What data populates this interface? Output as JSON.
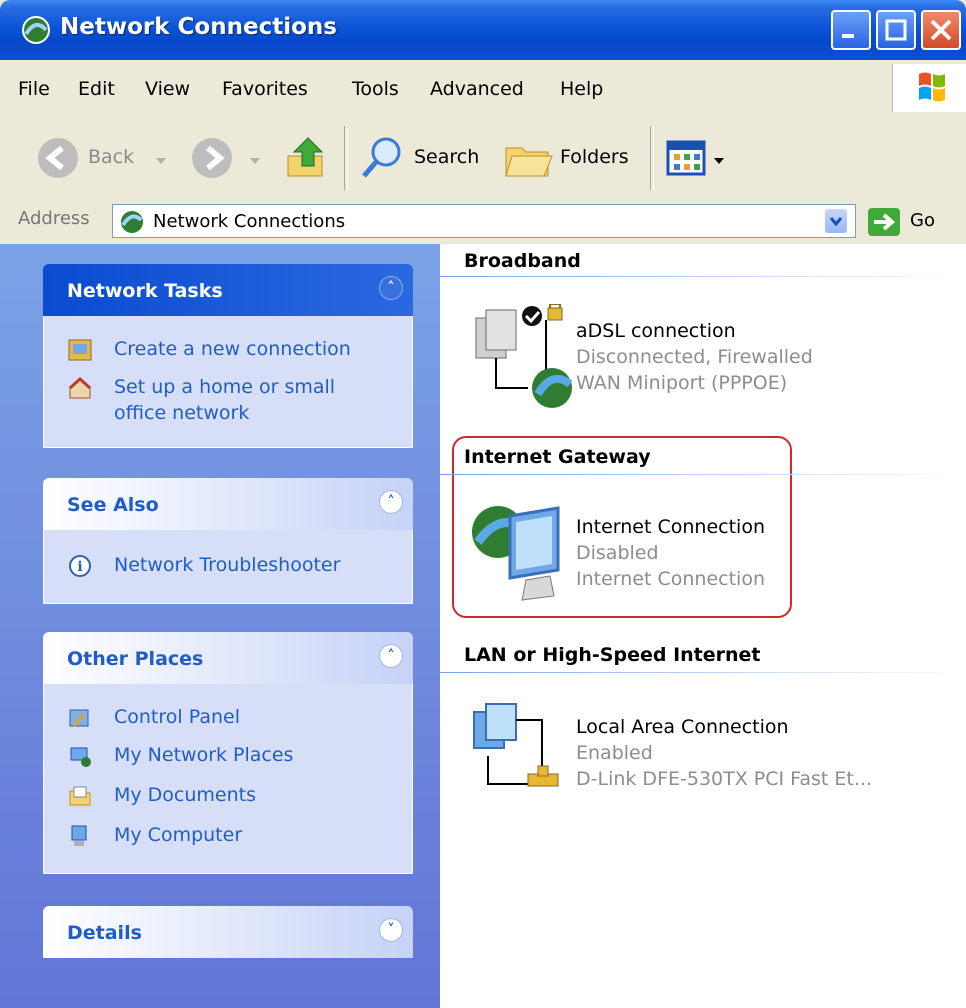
{
  "window": {
    "title": "Network Connections"
  },
  "menu": [
    "File",
    "Edit",
    "View",
    "Favorites",
    "Tools",
    "Advanced",
    "Help"
  ],
  "toolbar": {
    "back": "Back",
    "search": "Search",
    "folders": "Folders"
  },
  "address": {
    "label": "Address",
    "value": "Network Connections",
    "go": "Go"
  },
  "left_panels": {
    "network_tasks": {
      "title": "Network Tasks",
      "items": [
        "Create a new connection",
        "Set up a home or small",
        "office network"
      ]
    },
    "see_also": {
      "title": "See Also",
      "items": [
        "Network Troubleshooter"
      ]
    },
    "other_places": {
      "title": "Other Places",
      "items": [
        "Control Panel",
        "My Network Places",
        "My Documents",
        "My Computer"
      ]
    },
    "details": {
      "title": "Details"
    }
  },
  "groups": [
    {
      "title": "Broadband",
      "connection": {
        "name": "aDSL connection",
        "status": "Disconnected, Firewalled",
        "device": "WAN Miniport (PPPOE)"
      }
    },
    {
      "title": "Internet Gateway",
      "connection": {
        "name": "Internet Connection",
        "status": "Disabled",
        "device": "Internet Connection"
      }
    },
    {
      "title": "LAN or High-Speed Internet",
      "connection": {
        "name": "Local Area Connection",
        "status": "Enabled",
        "device": "D-Link DFE-530TX PCI Fast Et..."
      }
    }
  ],
  "colors": {
    "title_bar": "#0A55D8",
    "task_pane": "#6F8FE0",
    "link": "#215DC6",
    "highlight": "#D1282E"
  }
}
